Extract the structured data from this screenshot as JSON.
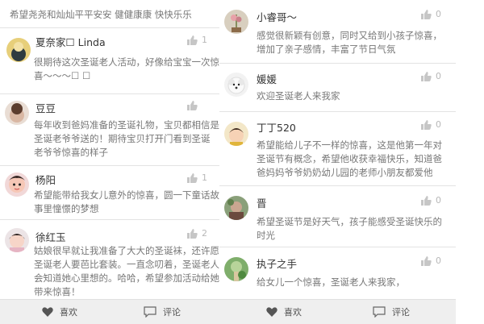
{
  "left": {
    "top_text": "希望尧尧和灿灿平平安安 健健康康 快快乐乐",
    "comments": [
      {
        "name": "夏奈家☐ Linda",
        "likes": "1",
        "text": [
          "很期待这次圣诞老人活动，好像给宝宝一次惊",
          "喜～～～☐ ☐"
        ]
      },
      {
        "name": "豆豆",
        "likes": "",
        "text": [
          "每年收到爸妈准备的圣诞礼物，宝贝都相信是",
          "圣诞老爷爷送的！期待宝贝打开门看到圣诞",
          "老爷爷惊喜的样子"
        ]
      },
      {
        "name": "杨阳",
        "likes": "1",
        "text": [
          "希望能带给我女儿意外的惊喜，圆一下童话故",
          "事里憧憬的梦想"
        ]
      },
      {
        "name": "徐红玉",
        "likes": "2",
        "text": [
          "姑娘很早就让我准备了大大的圣诞袜，还许愿",
          "圣诞老人要芭比套装。一直念叨着，圣诞老人",
          "会知道她心里想的。哈哈，希望参加活动给她",
          "带来惊喜！"
        ]
      }
    ]
  },
  "right": {
    "comments": [
      {
        "name": "小睿哥～",
        "likes": "0",
        "text": [
          "感觉很新颖有创意，同时又给到小孩子惊喜，",
          "增加了亲子感情，丰富了节日气氛"
        ]
      },
      {
        "name": "媛媛",
        "likes": "0",
        "text": [
          "欢迎圣诞老人来我家"
        ]
      },
      {
        "name": "丁丁520",
        "likes": "0",
        "text": [
          "希望能给儿子不一样的惊喜，这是他第一年对",
          "圣诞节有概念，希望他收获幸福快乐，知道爸",
          "爸妈妈爷爷奶奶幼儿园的老师小朋友都爱他"
        ]
      },
      {
        "name": "晋",
        "likes": "0",
        "text": [
          "希望圣诞节是好天气，孩子能感受圣诞快乐的",
          "时光"
        ]
      },
      {
        "name": "执子之手",
        "likes": "0",
        "text": [
          "给女儿一个惊喜，圣诞老人来我家，"
        ]
      }
    ]
  },
  "bottom_bar": {
    "like_label": "喜欢",
    "comment_label": "评论"
  }
}
